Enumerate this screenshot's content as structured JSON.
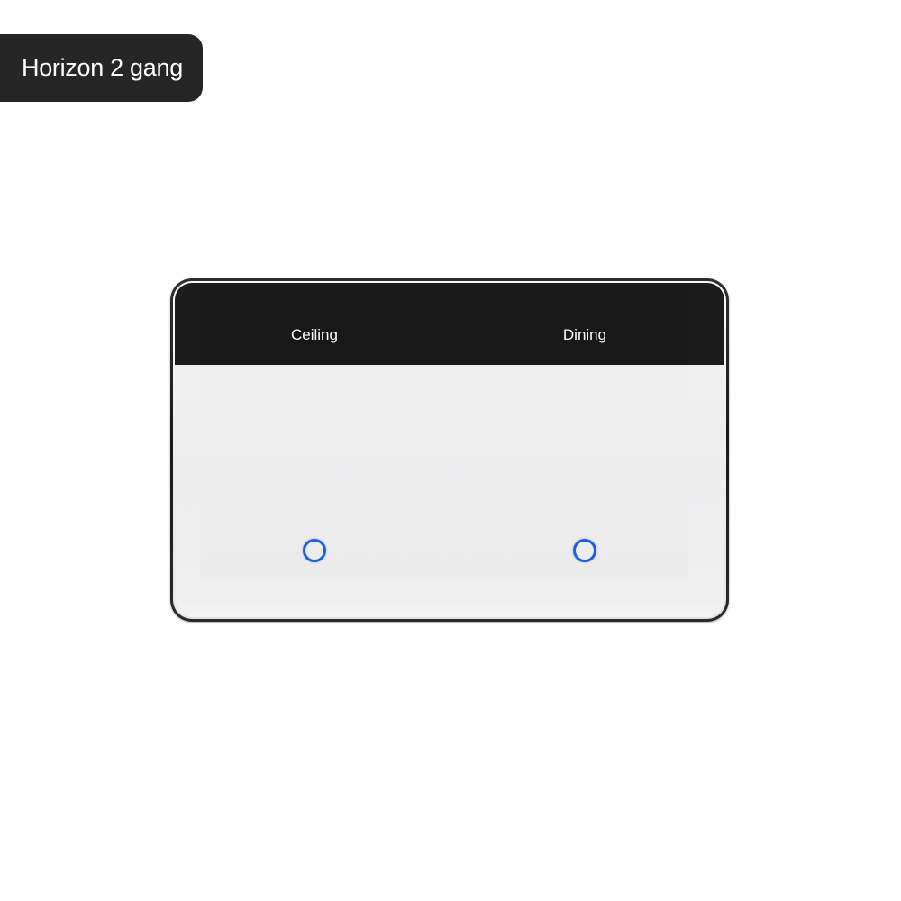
{
  "title": "Horizon 2 gang",
  "gangs": [
    {
      "label": "Ceiling",
      "indicator_color": "#1e5fe0"
    },
    {
      "label": "Dining",
      "indicator_color": "#1e5fe0"
    }
  ],
  "colors": {
    "badge_background": "#262626",
    "label_strip": "#1c1c1c",
    "panel_face": "#eeeeef",
    "indicator_ring": "#1e5fe0"
  }
}
